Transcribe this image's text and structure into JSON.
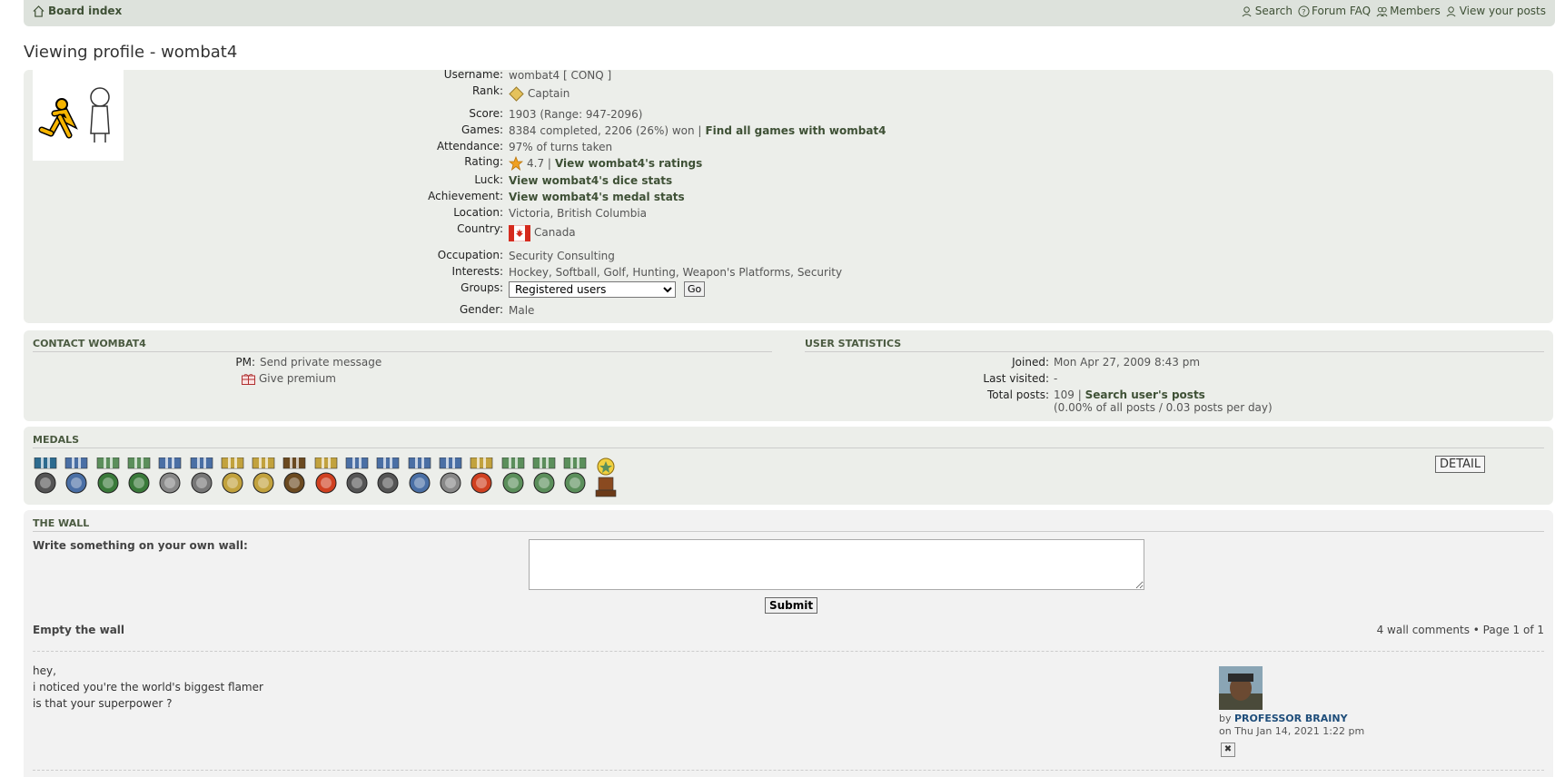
{
  "nav": {
    "board_index": "Board index",
    "search": "Search",
    "faq": "Forum FAQ",
    "members": "Members",
    "your_posts": "View your posts"
  },
  "title": "Viewing profile - wombat4",
  "profile": {
    "username_label": "Username:",
    "username_value": "wombat4 [ CONQ ]",
    "rank_label": "Rank:",
    "rank_value": "Captain",
    "score_label": "Score:",
    "score_value": "1903 (Range: 947-2096)",
    "games_label": "Games:",
    "games_value": "8384 completed, 2206 (26%) won |",
    "games_link": "Find all games with wombat4",
    "attendance_label": "Attendance:",
    "attendance_value": "97% of turns taken",
    "rating_label": "Rating:",
    "rating_value": "4.7 |",
    "rating_link": "View wombat4's ratings",
    "luck_label": "Luck:",
    "luck_link": "View wombat4's dice stats",
    "achievement_label": "Achievement:",
    "achievement_link": "View wombat4's medal stats",
    "location_label": "Location:",
    "location_value": "Victoria, British Columbia",
    "country_label": "Country:",
    "country_value": "Canada",
    "occupation_label": "Occupation:",
    "occupation_value": "Security Consulting",
    "interests_label": "Interests:",
    "interests_value": "Hockey, Softball, Golf, Hunting, Weapon's Platforms, Security",
    "groups_label": "Groups:",
    "groups_selected": "Registered users",
    "groups_go": "Go",
    "gender_label": "Gender:",
    "gender_value": "Male"
  },
  "contact": {
    "head": "CONTACT WOMBAT4",
    "pm_label": "PM:",
    "pm_link": "Send private message",
    "premium_link": "Give premium"
  },
  "stats": {
    "head": "USER STATISTICS",
    "joined_label": "Joined:",
    "joined_value": "Mon Apr 27, 2009 8:43 pm",
    "visited_label": "Last visited:",
    "visited_value": "-",
    "posts_label": "Total posts:",
    "posts_value": "109 |",
    "posts_link": "Search user's posts",
    "posts_sub": "(0.00% of all posts / 0.03 posts per day)"
  },
  "medals": {
    "head": "MEDALS",
    "detail": "DETAIL"
  },
  "wall": {
    "head": "THE WALL",
    "write_label": "Write something on your own wall:",
    "submit": "Submit",
    "empty": "Empty the wall",
    "count": "4 wall comments • Page 1 of 1",
    "comment_lines": [
      "hey,",
      "i noticed you're the world's biggest flamer",
      "is that your superpower ?"
    ],
    "by": "by",
    "author": "PROFESSOR BRAINY",
    "date": "on Thu Jan 14, 2021 1:22 pm"
  }
}
